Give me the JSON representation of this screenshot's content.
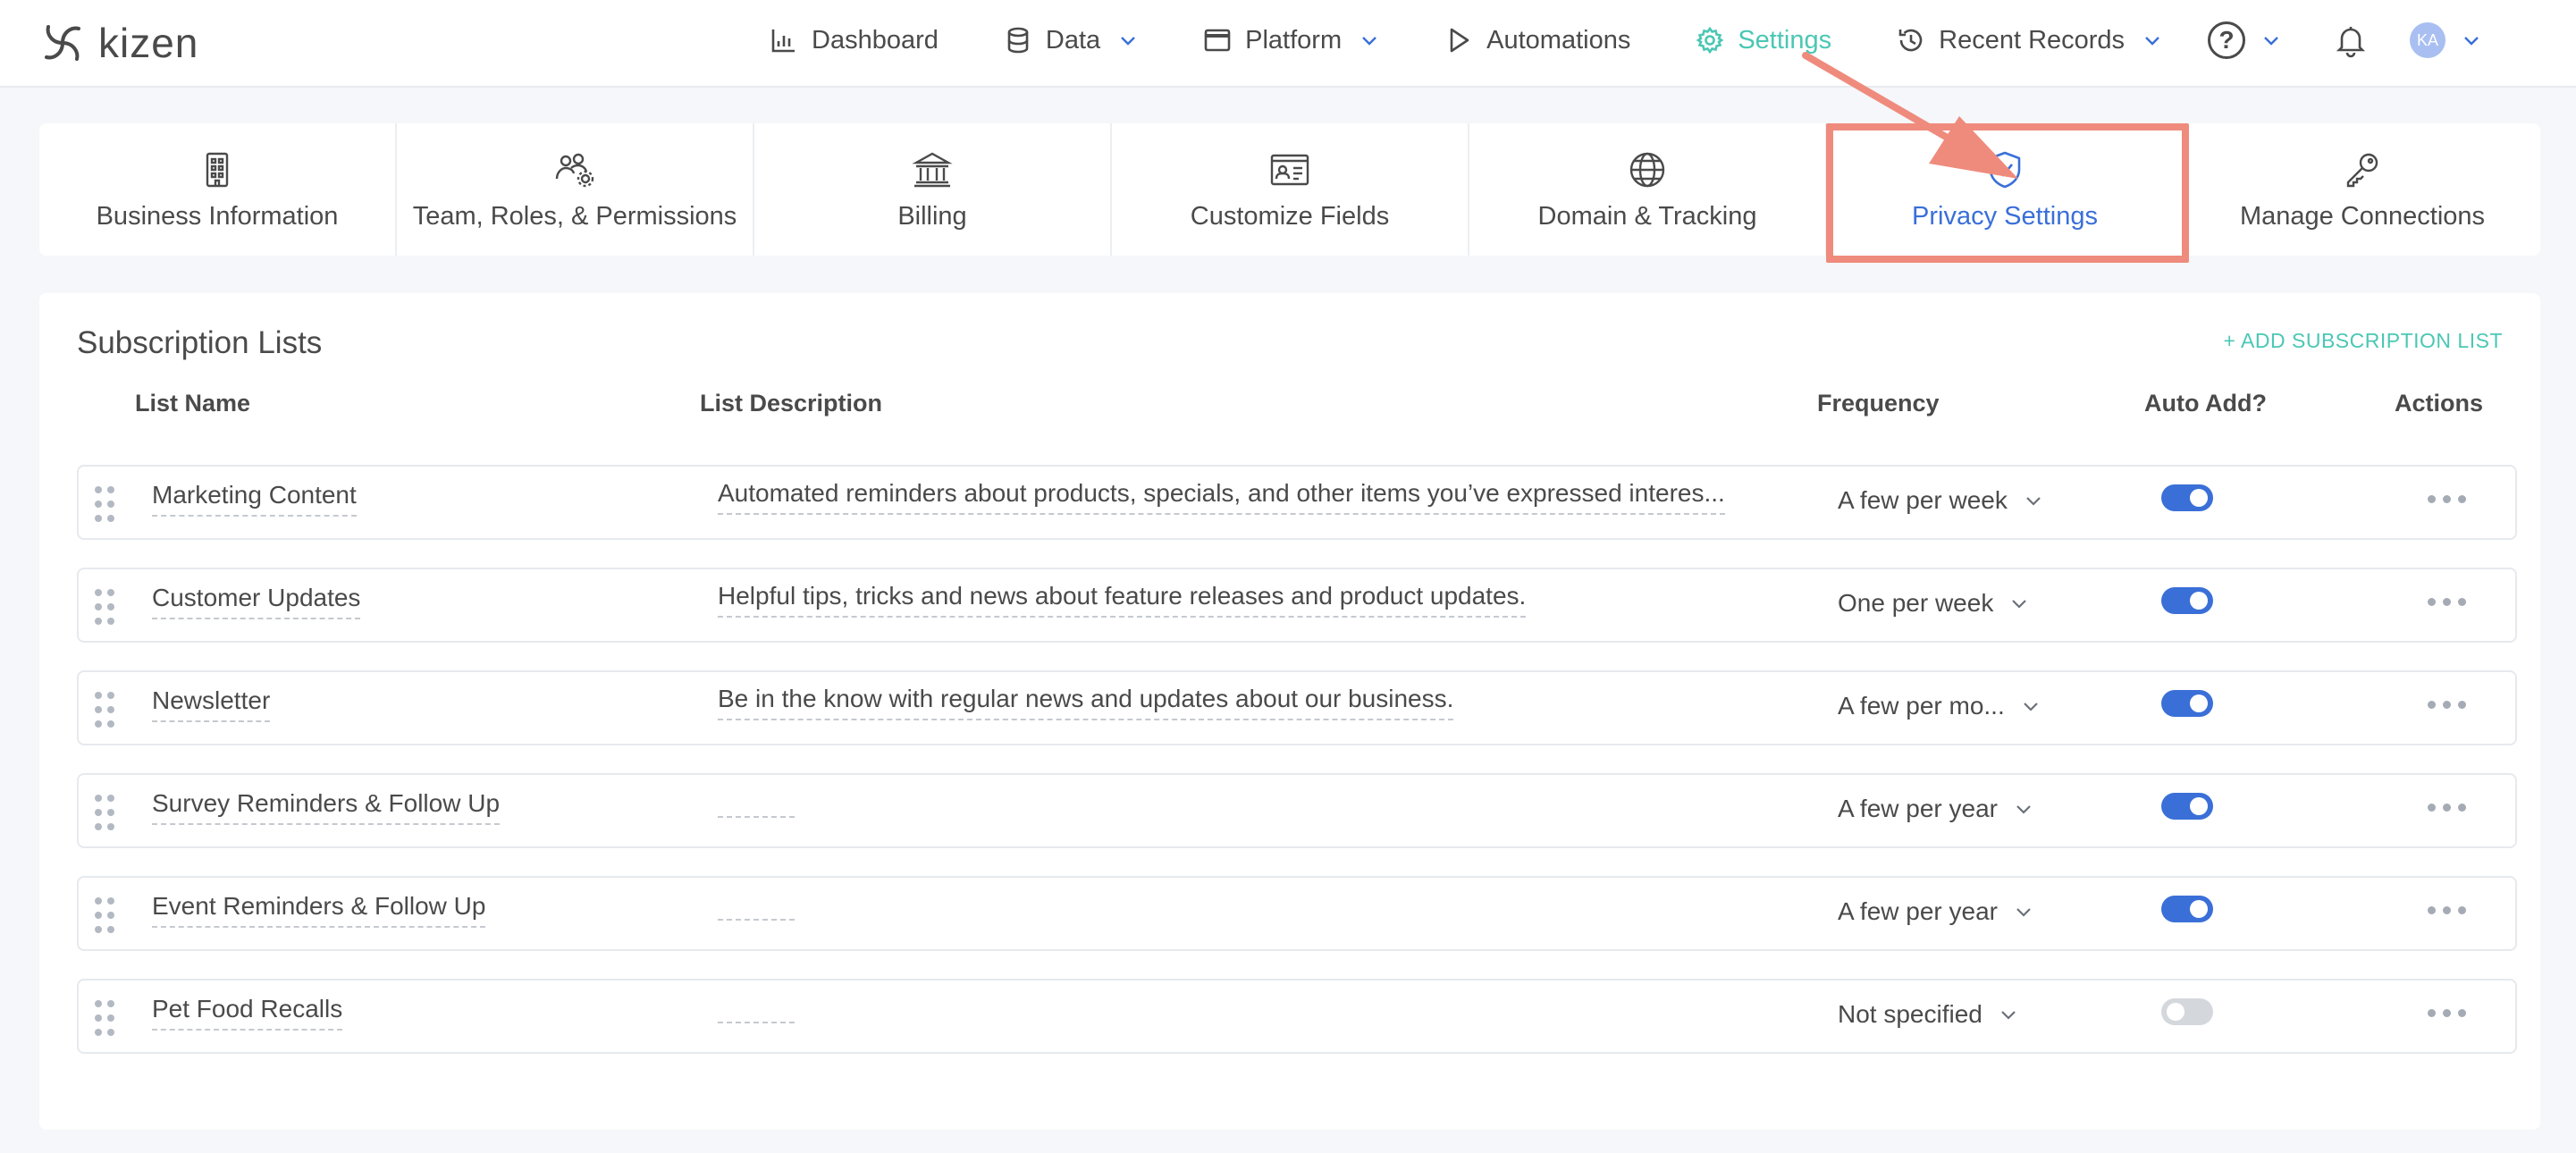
{
  "brand": {
    "name": "kizen"
  },
  "nav": {
    "items": [
      {
        "label": "Dashboard",
        "icon": "bar-chart-icon",
        "dropdown": false,
        "active": false
      },
      {
        "label": "Data",
        "icon": "database-icon",
        "dropdown": true,
        "active": false
      },
      {
        "label": "Platform",
        "icon": "window-icon",
        "dropdown": true,
        "active": false
      },
      {
        "label": "Automations",
        "icon": "play-icon",
        "dropdown": false,
        "active": false
      },
      {
        "label": "Settings",
        "icon": "gear-icon",
        "dropdown": false,
        "active": true
      },
      {
        "label": "Recent Records",
        "icon": "history-icon",
        "dropdown": true,
        "active": false
      }
    ],
    "help_symbol": "?",
    "avatar_initials": "KA"
  },
  "settings_tabs": [
    {
      "label": "Business Information",
      "icon": "building-icon"
    },
    {
      "label": "Team, Roles, & Permissions",
      "icon": "team-icon"
    },
    {
      "label": "Billing",
      "icon": "bank-icon"
    },
    {
      "label": "Customize Fields",
      "icon": "id-card-icon"
    },
    {
      "label": "Domain & Tracking",
      "icon": "globe-icon"
    },
    {
      "label": "Privacy Settings",
      "icon": "shield-check-icon",
      "active": true
    },
    {
      "label": "Manage Connections",
      "icon": "key-icon"
    }
  ],
  "subscriptions": {
    "title": "Subscription Lists",
    "add_label": "+ ADD SUBSCRIPTION LIST",
    "columns": {
      "name": "List Name",
      "description": "List Description",
      "frequency": "Frequency",
      "auto_add": "Auto Add?",
      "actions": "Actions"
    },
    "rows": [
      {
        "name": "Marketing Content",
        "description": "Automated reminders about products, specials, and other items you’ve expressed interes...",
        "frequency": "A few per week",
        "auto_add": true
      },
      {
        "name": "Customer Updates",
        "description": "Helpful tips, tricks and news about feature releases and product updates.",
        "frequency": "One per week",
        "auto_add": true
      },
      {
        "name": "Newsletter",
        "description": "Be in the know with regular news and updates about our business.",
        "frequency": "A few per mo...",
        "auto_add": true
      },
      {
        "name": "Survey Reminders & Follow Up",
        "description": "",
        "frequency": "A few per year",
        "auto_add": true
      },
      {
        "name": "Event Reminders & Follow Up",
        "description": "",
        "frequency": "A few per year",
        "auto_add": true
      },
      {
        "name": "Pet Food Recalls",
        "description": "",
        "frequency": "Not specified",
        "auto_add": false
      }
    ]
  },
  "colors": {
    "accent_teal": "#4bc7b4",
    "accent_blue": "#3a6fd8",
    "highlight": "#ef8b7d"
  }
}
